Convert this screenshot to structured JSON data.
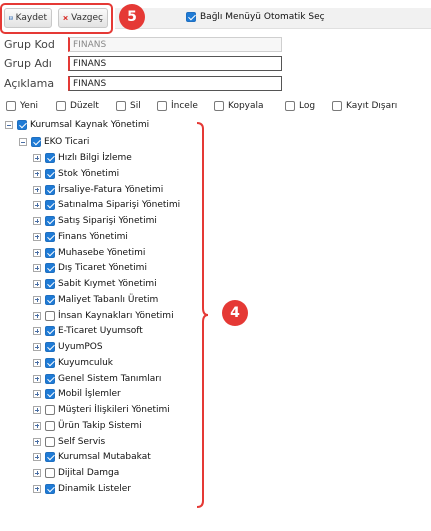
{
  "toolbar": {
    "save_label": "Kaydet",
    "cancel_label": "Vazgeç",
    "auto_select_label": "Bağlı Menüyü Otomatik Seç",
    "auto_select_checked": true
  },
  "form": {
    "group_code_label": "Grup Kod",
    "group_code_value": "FINANS",
    "group_name_label": "Grup Adı",
    "group_name_value": "FINANS",
    "description_label": "Açıklama",
    "description_value": "FINANS"
  },
  "permissions": [
    {
      "label": "Yeni",
      "checked": false
    },
    {
      "label": "Düzelt",
      "checked": false
    },
    {
      "label": "Sil",
      "checked": false
    },
    {
      "label": "İncele",
      "checked": false
    },
    {
      "label": "Kopyala",
      "checked": false
    },
    {
      "label": "Log",
      "checked": false
    },
    {
      "label": "Kayıt Dışarı",
      "checked": false
    }
  ],
  "tree": {
    "root": {
      "label": "Kurumsal Kaynak Yönetimi",
      "checked": true,
      "expanded": true
    },
    "group": {
      "label": "EKO Ticari",
      "checked": true,
      "expanded": true
    },
    "modules": [
      {
        "label": "Hızlı Bilgi İzleme",
        "checked": true
      },
      {
        "label": "Stok Yönetimi",
        "checked": true
      },
      {
        "label": "İrsaliye-Fatura Yönetimi",
        "checked": true
      },
      {
        "label": "Satınalma Siparişi Yönetimi",
        "checked": true
      },
      {
        "label": "Satış Siparişi Yönetimi",
        "checked": true
      },
      {
        "label": "Finans Yönetimi",
        "checked": true
      },
      {
        "label": "Muhasebe Yönetimi",
        "checked": true
      },
      {
        "label": "Dış Ticaret Yönetimi",
        "checked": true
      },
      {
        "label": "Sabit Kıymet Yönetimi",
        "checked": true
      },
      {
        "label": "Maliyet Tabanlı Üretim",
        "checked": true
      },
      {
        "label": "İnsan Kaynakları Yönetimi",
        "checked": false
      },
      {
        "label": "E-Ticaret Uyumsoft",
        "checked": true
      },
      {
        "label": "UyumPOS",
        "checked": true
      },
      {
        "label": "Kuyumculuk",
        "checked": true
      },
      {
        "label": "Genel Sistem Tanımları",
        "checked": true
      },
      {
        "label": "Mobil İşlemler",
        "checked": true
      },
      {
        "label": "Müşteri İlişkileri Yönetimi",
        "checked": false
      },
      {
        "label": "Ürün Takip Sistemi",
        "checked": false
      },
      {
        "label": "Self Servis",
        "checked": false
      },
      {
        "label": "Kurumsal Mutabakat",
        "checked": true
      },
      {
        "label": "Dijital Damga",
        "checked": false
      },
      {
        "label": "Dinamik Listeler",
        "checked": true
      }
    ]
  },
  "annotations": {
    "badge_toolbar": "5",
    "badge_tree": "4"
  },
  "colors": {
    "accent": "#1f7bd6",
    "callout": "#e53935"
  }
}
